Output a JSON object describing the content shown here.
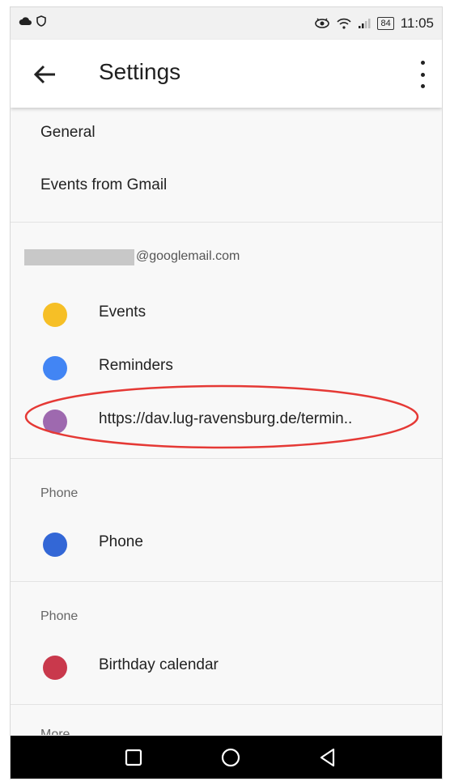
{
  "statusbar": {
    "time": "11:05",
    "battery": "84"
  },
  "appbar": {
    "title": "Settings"
  },
  "general_items": [
    {
      "label": "General"
    },
    {
      "label": "Events from Gmail"
    }
  ],
  "account": {
    "email_suffix": "@googlemail.com",
    "calendars": [
      {
        "label": "Events",
        "color": "#F6BF26"
      },
      {
        "label": "Reminders",
        "color": "#4285F4"
      },
      {
        "label": "https://dav.lug-ravensburg.de/termin..",
        "color": "#9E69AF"
      }
    ]
  },
  "phone_section": {
    "label": "Phone",
    "calendars": [
      {
        "label": "Phone",
        "color": "#3367D6"
      }
    ]
  },
  "birthday_section": {
    "label": "Phone",
    "calendars": [
      {
        "label": "Birthday calendar",
        "color": "#C9394C"
      }
    ]
  },
  "more_section": {
    "label": "More"
  },
  "highlight_color": "#E53935"
}
